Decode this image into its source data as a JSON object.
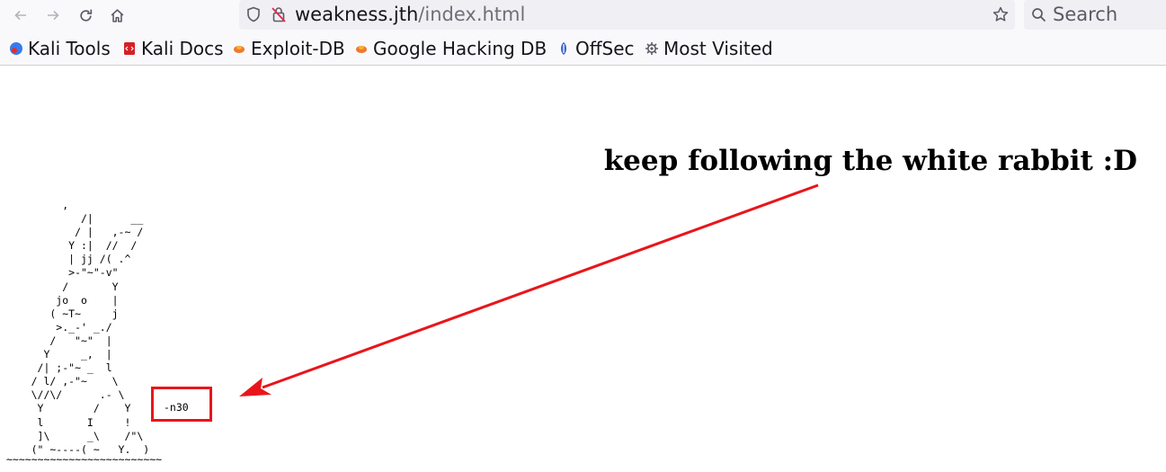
{
  "browser": {
    "url_host": "weakness.jth",
    "url_path": "/index.html",
    "search_placeholder": "Search"
  },
  "bookmarks": [
    {
      "label": "Kali Tools",
      "icon": "kali-tools-icon"
    },
    {
      "label": "Kali Docs",
      "icon": "kali-docs-icon"
    },
    {
      "label": "Exploit-DB",
      "icon": "exploit-db-icon"
    },
    {
      "label": "Google Hacking DB",
      "icon": "google-hacking-db-icon"
    },
    {
      "label": "OffSec",
      "icon": "offsec-icon"
    },
    {
      "label": "Most Visited",
      "icon": "gear-icon"
    }
  ],
  "page": {
    "headline": "keep following the white rabbit :D",
    "ascii_art": "          ,\n             /|      __\n            / |   ,-~ /\n           Y :|  //  /\n           | jj /( .^\n           >-\"~\"-v\"\n          /       Y\n         jo  o    |\n        ( ~T~     j\n         >._-' _./\n        /   \"~\"  |\n       Y     _,  |\n      /| ;-\"~ _  l\n     / l/ ,-\"~    \\\n     \\//\\/      .- \\\n      Y        /    Y\n      l       I     !\n      ]\\      _\\    /\"\\\n     (\" ~----( ~   Y.  )",
    "ascii_baseline": "~~~~~~~~~~~~~~~~~~~~~~~~~",
    "highlighted_code": "-n30"
  },
  "colors": {
    "annotation_red": "#e8161b"
  }
}
